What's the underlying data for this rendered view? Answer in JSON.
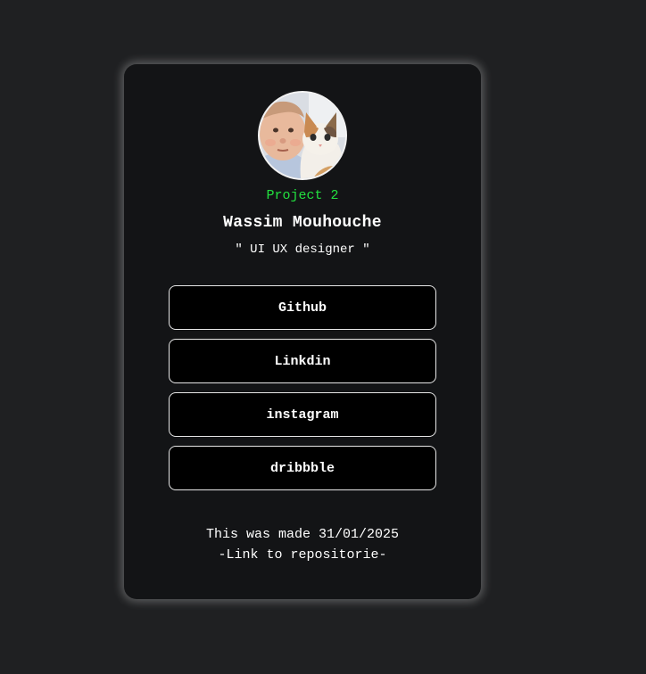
{
  "profile": {
    "project_label": "Project 2",
    "name": "Wassim Mouhouche",
    "role": "\" UI UX designer \""
  },
  "links": [
    {
      "label": "Github"
    },
    {
      "label": "Linkdin"
    },
    {
      "label": "instagram"
    },
    {
      "label": "dribbble"
    }
  ],
  "footer": {
    "made_text": "This was made 31/01/2025",
    "repo_link": "-Link to repositorie-"
  },
  "colors": {
    "page_background": "#1f2022",
    "card_background": "#131416",
    "project_label": "#22e03f",
    "button_background": "#000000",
    "button_border": "#e6e6e6"
  }
}
